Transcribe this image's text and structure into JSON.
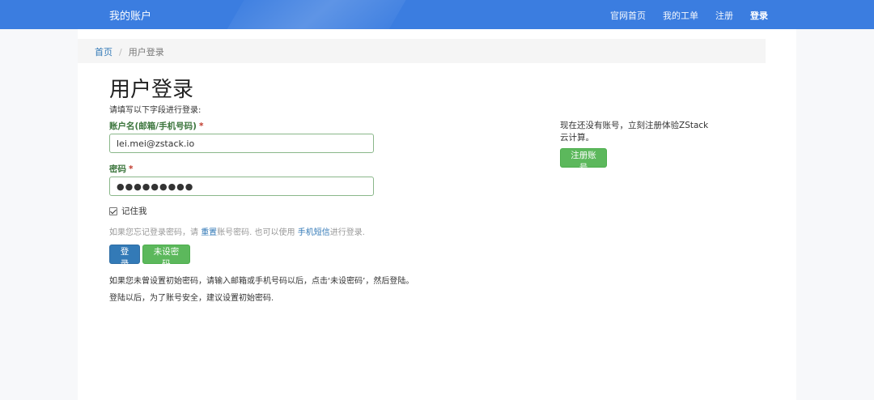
{
  "navbar": {
    "brand": "我的账户",
    "links": [
      "官网首页",
      "我的工单",
      "注册",
      "登录"
    ]
  },
  "breadcrumb": {
    "home": "首页",
    "separator": "/",
    "current": "用户登录"
  },
  "form": {
    "title": "用户登录",
    "intro": "请填写以下字段进行登录:",
    "account_label": "账户名(邮箱/手机号码)",
    "account_value": "lei.mei@zstack.io",
    "password_label": "密码",
    "password_value": "●●●●●●●●●",
    "required_mark": "*",
    "remember_label": "记住我",
    "help": {
      "part1": "如果您忘记登录密码，请 ",
      "reset_link": "重置",
      "part2": "账号密码. 也可以使用 ",
      "sms_link": "手机短信",
      "part3": "进行登录."
    },
    "login_button": "登录",
    "no_password_button": "未设密码",
    "note1": "如果您未曾设置初始密码，请输入邮箱或手机号码以后，点击‘未设密码’，然后登陆。",
    "note2": "登陆以后，为了账号安全，建议设置初始密码."
  },
  "sidebar": {
    "text": "现在还没有账号，立刻注册体验ZStack云计算。",
    "register_button": "注册账号"
  },
  "colors": {
    "navbar": "#3b7de0",
    "primary": "#337ab7",
    "success": "#5cb85c",
    "label_green": "#3c763d"
  }
}
